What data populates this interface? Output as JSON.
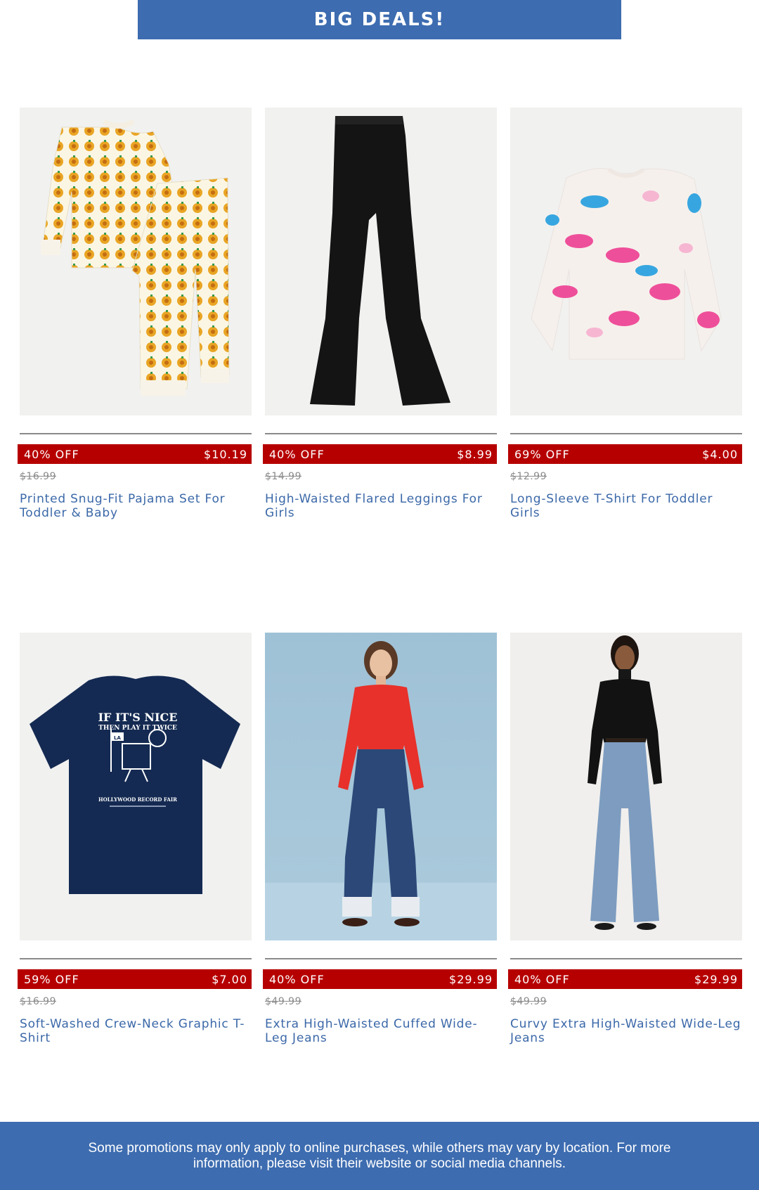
{
  "banner": {
    "title": "BIG DEALS!"
  },
  "products": [
    {
      "image_icon": "pajama-set-image",
      "discount": "40% OFF",
      "sale_price": "$10.19",
      "original_price": "$16.99",
      "title": "Printed Snug-Fit Pajama Set For Toddler & Baby"
    },
    {
      "image_icon": "flared-leggings-image",
      "discount": "40% OFF",
      "sale_price": "$8.99",
      "original_price": "$14.99",
      "title": "High-Waisted Flared Leggings For Girls"
    },
    {
      "image_icon": "dino-tshirt-image",
      "discount": "69% OFF",
      "sale_price": "$4.00",
      "original_price": "$12.99",
      "title": "Long-Sleeve T-Shirt For Toddler Girls"
    },
    {
      "image_icon": "graphic-tshirt-image",
      "discount": "59% OFF",
      "sale_price": "$7.00",
      "original_price": "$16.99",
      "title": "Soft-Washed Crew-Neck Graphic T-Shirt"
    },
    {
      "image_icon": "cuffed-jeans-model-image",
      "discount": "40% OFF",
      "sale_price": "$29.99",
      "original_price": "$49.99",
      "title": "Extra High-Waisted Cuffed Wide-Leg Jeans"
    },
    {
      "image_icon": "wide-leg-jeans-model-image",
      "discount": "40% OFF",
      "sale_price": "$29.99",
      "original_price": "$49.99",
      "title": "Curvy Extra High-Waisted Wide-Leg Jeans"
    }
  ],
  "tshirt_graphic": {
    "line1": "IF IT'S NICE",
    "line2": "THEN PLAY IT TWICE",
    "flag": "LA",
    "footer": "HOLLYWOOD RECORD FAIR"
  },
  "footer": {
    "text": "Some promotions may only apply to online purchases, while others may vary by location. For more information, please visit their website or social media channels."
  },
  "colors": {
    "brand_blue": "#3d6cb0",
    "sale_red": "#b60000",
    "title_blue": "#3b68a8"
  }
}
